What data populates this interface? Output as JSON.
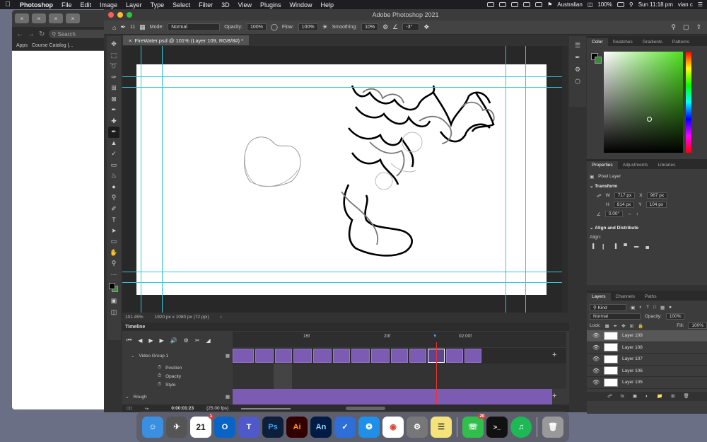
{
  "menubar": {
    "app": "Photoshop",
    "items": [
      "File",
      "Edit",
      "Image",
      "Layer",
      "Type",
      "Select",
      "Filter",
      "3D",
      "View",
      "Plugins",
      "Window",
      "Help"
    ],
    "keyboard": "Australian",
    "battery": "100%",
    "datetime": "Sun 11:18 pm",
    "user": "vian c"
  },
  "browser": {
    "search_placeholder": "Search",
    "bookmarks": [
      "Apps",
      "Course Catalog |..."
    ]
  },
  "window": {
    "title": "Adobe Photoshop 2021"
  },
  "options": {
    "brush_size": "11",
    "mode_label": "Mode:",
    "mode": "Normal",
    "opacity_label": "Opacity:",
    "opacity": "100%",
    "flow_label": "Flow:",
    "flow": "100%",
    "smoothing_label": "Smoothing:",
    "smoothing": "10%",
    "angle": "-3°"
  },
  "document": {
    "tab_title": "FireWater.psd @ 101% (Layer 109, RGB/8#) *",
    "zoom": "101.45%",
    "size": "1920 px x 1080 px (72 ppi)"
  },
  "timeline": {
    "title": "Timeline",
    "ruler_labels": [
      "15f",
      "20f",
      "02:00f"
    ],
    "group": "Video Group 1",
    "props": [
      "Position",
      "Opacity",
      "Style"
    ],
    "second_group": "Rough",
    "timecode": "0:00:01:23",
    "fps": "(25.00 fps)"
  },
  "color_panel": {
    "tabs": [
      "Color",
      "Swatches",
      "Gradients",
      "Patterns"
    ],
    "fg": "#000000",
    "bg": "#3a8a3a"
  },
  "properties": {
    "tabs": [
      "Properties",
      "Adjustments",
      "Libraries"
    ],
    "kind": "Pixel Layer",
    "transform_title": "Transform",
    "w_label": "W",
    "w": "717 px",
    "x_label": "X",
    "x": "967 px",
    "h_label": "H",
    "h": "814 px",
    "y_label": "Y",
    "y": "104 px",
    "angle": "0.00°",
    "align_title": "Align and Distribute",
    "align_label": "Align:"
  },
  "layers_panel": {
    "tabs": [
      "Layers",
      "Channels",
      "Paths"
    ],
    "filter": "Kind",
    "blend": "Normal",
    "opacity_label": "Opacity:",
    "opacity": "100%",
    "lock_label": "Lock:",
    "fill_label": "Fill:",
    "fill": "100%",
    "layers": [
      "Layer 109",
      "Layer 108",
      "Layer 107",
      "Layer 106",
      "Layer 105"
    ]
  },
  "dock": {
    "calendar_day": "21",
    "calendar_badge": "1",
    "facetime_badge": "20",
    "apps": [
      "Ps",
      "Ai",
      "An"
    ]
  }
}
